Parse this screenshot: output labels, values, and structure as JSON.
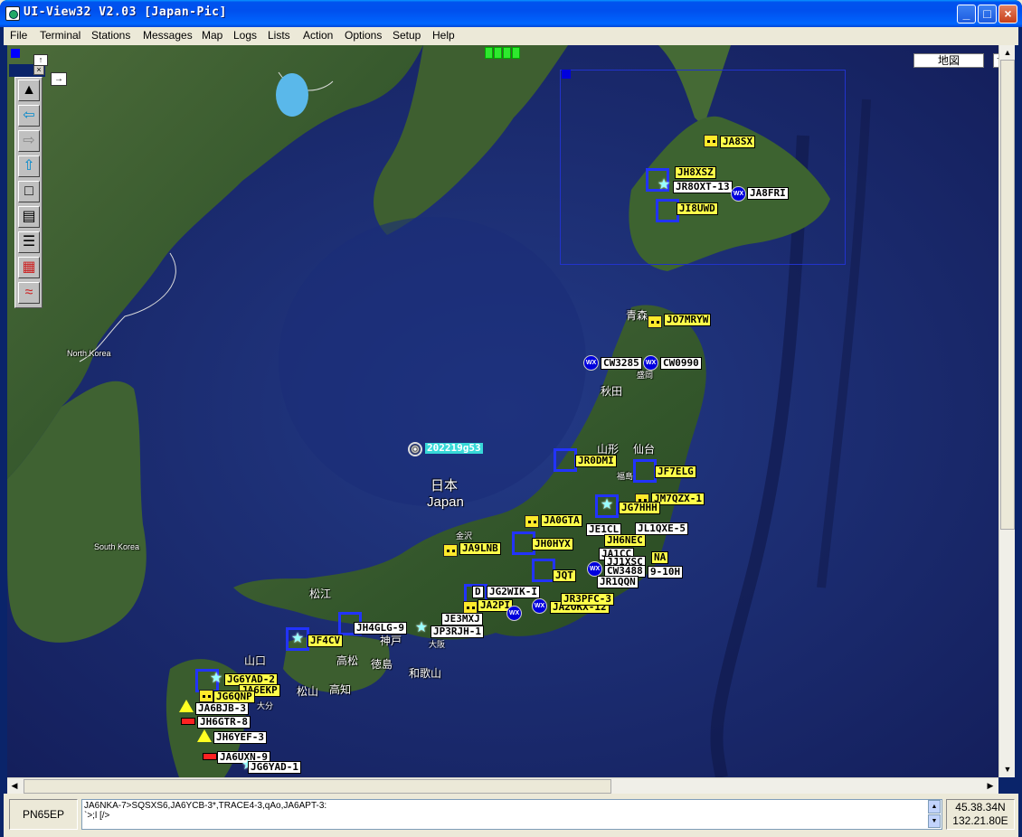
{
  "window": {
    "title": "UI-View32 V2.03 [Japan-Pic]",
    "minimize": "_",
    "maximize": "□",
    "close": "×"
  },
  "menu": [
    "File",
    "Terminal",
    "Stations",
    "Messages",
    "Map",
    "Logs",
    "Lists",
    "Action",
    "Options",
    "Setup",
    "Help"
  ],
  "map_controls": {
    "map_name_button": "地図",
    "map_toggle": "−"
  },
  "toolbar": {
    "close_label": "×",
    "expand_label": "→",
    "collapse_label": "↑",
    "buttons": [
      {
        "icon": "map-icon",
        "glyph": "▲"
      },
      {
        "icon": "back-arrow-icon",
        "glyph": "⇦"
      },
      {
        "icon": "forward-arrow-icon",
        "glyph": "⇨"
      },
      {
        "icon": "up-arrow-icon",
        "glyph": "⇧"
      },
      {
        "icon": "square-icon",
        "glyph": "□"
      },
      {
        "icon": "terminal-icon",
        "glyph": "▤"
      },
      {
        "icon": "list-icon",
        "glyph": "☰"
      },
      {
        "icon": "calendar-icon",
        "glyph": "▦"
      },
      {
        "icon": "waves-icon",
        "glyph": "≈"
      }
    ]
  },
  "places": {
    "north_korea": "North Korea",
    "south_korea": "South Korea",
    "japan_jp": "日本",
    "japan_en": "Japan",
    "aomori": "青森",
    "akita": "秋田",
    "yamagata": "山形",
    "sendai": "仙台",
    "fukushima": "福島",
    "kanazawa": "金沢",
    "matsue": "松江",
    "yamaguchi": "山口",
    "takamatsu": "高松",
    "tokushima": "徳島",
    "matsuyama": "松山",
    "kochi": "高知",
    "wakayama": "和歌山",
    "kobe": "神戸",
    "osaka": "大阪",
    "oita": "大分",
    "morioka": "盛岡"
  },
  "stations": [
    {
      "call": "JA8SX",
      "style": "yellow"
    },
    {
      "call": "JH8XSZ",
      "style": "yellow"
    },
    {
      "call": "JR8OXT-13",
      "style": "white"
    },
    {
      "call": "JA8FRI",
      "style": "white"
    },
    {
      "call": "JI8UWD",
      "style": "yellow"
    },
    {
      "call": "JO7MRYW",
      "style": "yellow"
    },
    {
      "call": "CW3285",
      "style": "white"
    },
    {
      "call": "CW0990",
      "style": "white"
    },
    {
      "call": "202219g53",
      "style": "cyan"
    },
    {
      "call": "JR0DMI",
      "style": "yellow"
    },
    {
      "call": "JF7ELG",
      "style": "yellow"
    },
    {
      "call": "JM7QZX-1",
      "style": "yellow"
    },
    {
      "call": "JG7HHH",
      "style": "yellow"
    },
    {
      "call": "JA0GTA",
      "style": "yellow"
    },
    {
      "call": "JE1CL",
      "style": "white"
    },
    {
      "call": "JL1QXE-5",
      "style": "white"
    },
    {
      "call": "JA9LNB",
      "style": "yellow"
    },
    {
      "call": "JH0HYX",
      "style": "yellow"
    },
    {
      "call": "JH6NEC",
      "style": "yellow"
    },
    {
      "call": "JA1CC",
      "style": "white"
    },
    {
      "call": "JJ1XSC",
      "style": "white"
    },
    {
      "call": "NA",
      "style": "yellow"
    },
    {
      "call": "CW3488",
      "style": "white"
    },
    {
      "call": "9-10H",
      "style": "white"
    },
    {
      "call": "JQT",
      "style": "yellow"
    },
    {
      "call": "JR1QQN",
      "style": "white"
    },
    {
      "call": "D",
      "style": "white"
    },
    {
      "call": "JG2WIK-I",
      "style": "white"
    },
    {
      "call": "JA2PI",
      "style": "yellow"
    },
    {
      "call": "JE3MXJ",
      "style": "white"
    },
    {
      "call": "JA2OKX-12",
      "style": "yellow"
    },
    {
      "call": "JR3PFC-3",
      "style": "yellow"
    },
    {
      "call": "JH4GLG-9",
      "style": "white"
    },
    {
      "call": "JP3RJH-1",
      "style": "white"
    },
    {
      "call": "JF4CV",
      "style": "yellow"
    },
    {
      "call": "JG6YAD-2",
      "style": "yellow"
    },
    {
      "call": "JA6EKP",
      "style": "yellow"
    },
    {
      "call": "JG6QNP",
      "style": "yellow"
    },
    {
      "call": "JA6BJB-3",
      "style": "white"
    },
    {
      "call": "JH6GTR-8",
      "style": "white"
    },
    {
      "call": "JH6YEF-3",
      "style": "white"
    },
    {
      "call": "JA6UXN-9",
      "style": "white"
    },
    {
      "call": "JG6YAD-1",
      "style": "white"
    }
  ],
  "status": {
    "locator": "PN65EP",
    "message_line1": "JA6NKA-7>SQSXS6,JA6YCB-3*,TRACE4-3,qAo,JA6APT-3:",
    "message_line2": "`>;l [/>",
    "latitude": "45.38.34N",
    "longitude": "132.21.80E"
  }
}
